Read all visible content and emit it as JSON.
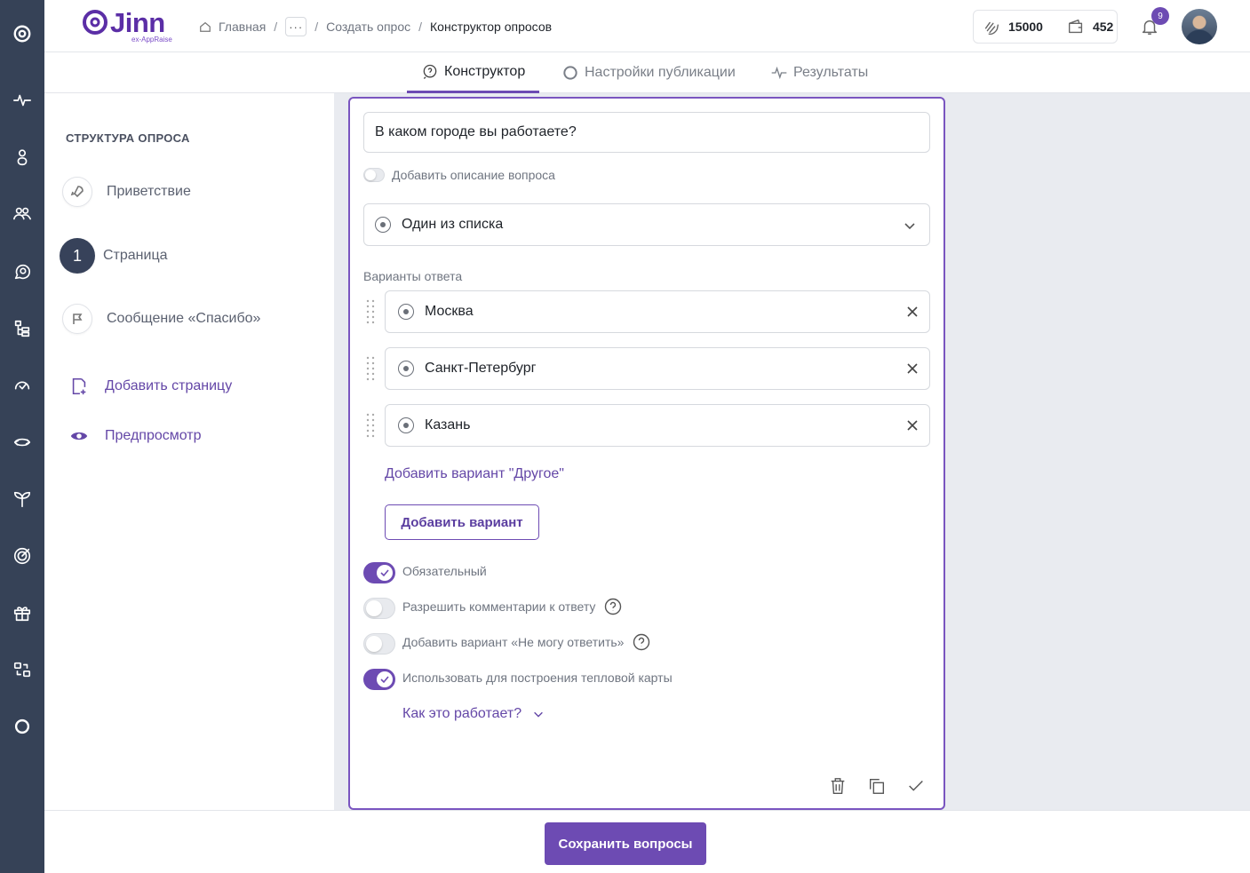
{
  "app": {
    "logo_text": "Jinn",
    "logo_subtitle": "ex-AppRaise",
    "brand_color": "#6d4bb3"
  },
  "breadcrumb": {
    "home": "Главная",
    "more": "···",
    "step": "Создать опрос",
    "current": "Конструктор опросов"
  },
  "header": {
    "thanks_balance": "15000",
    "wallet_balance": "452",
    "notifications_count": "9"
  },
  "tabs": [
    {
      "label": "Конструктор",
      "icon": "question-bubble-icon",
      "active": true
    },
    {
      "label": "Настройки публикации",
      "icon": "gear-icon",
      "active": false
    },
    {
      "label": "Результаты",
      "icon": "pulse-icon",
      "active": false
    }
  ],
  "structure": {
    "title": "СТРУКТУРА ОПРОСА",
    "items": [
      {
        "label": "Приветствие",
        "icon": "rocket-icon"
      },
      {
        "label": "Страница",
        "number": "1"
      },
      {
        "label": "Сообщение «Спасибо»",
        "icon": "flag-icon"
      }
    ],
    "add_page": "Добавить страницу",
    "preview": "Предпросмотр"
  },
  "question": {
    "title_value": "В каком городе вы работаете?",
    "add_description": "Добавить описание вопроса",
    "type_value": "Один из списка",
    "options_label": "Варианты ответа",
    "options": [
      "Москва",
      "Санкт-Петербург",
      "Казань"
    ],
    "add_other": "Добавить вариант \"Другое\"",
    "add_option": "Добавить вариант",
    "toggles": [
      {
        "label": "Обязательный",
        "on": true
      },
      {
        "label": "Разрешить комментарии к ответу",
        "on": false,
        "help": true
      },
      {
        "label": "Добавить вариант «Не могу ответить»",
        "on": false,
        "help": true
      },
      {
        "label": "Использовать для построения тепловой карты",
        "on": true
      }
    ],
    "how_it_works": "Как это работает?"
  },
  "footer": {
    "save_label": "Сохранить вопросы"
  }
}
